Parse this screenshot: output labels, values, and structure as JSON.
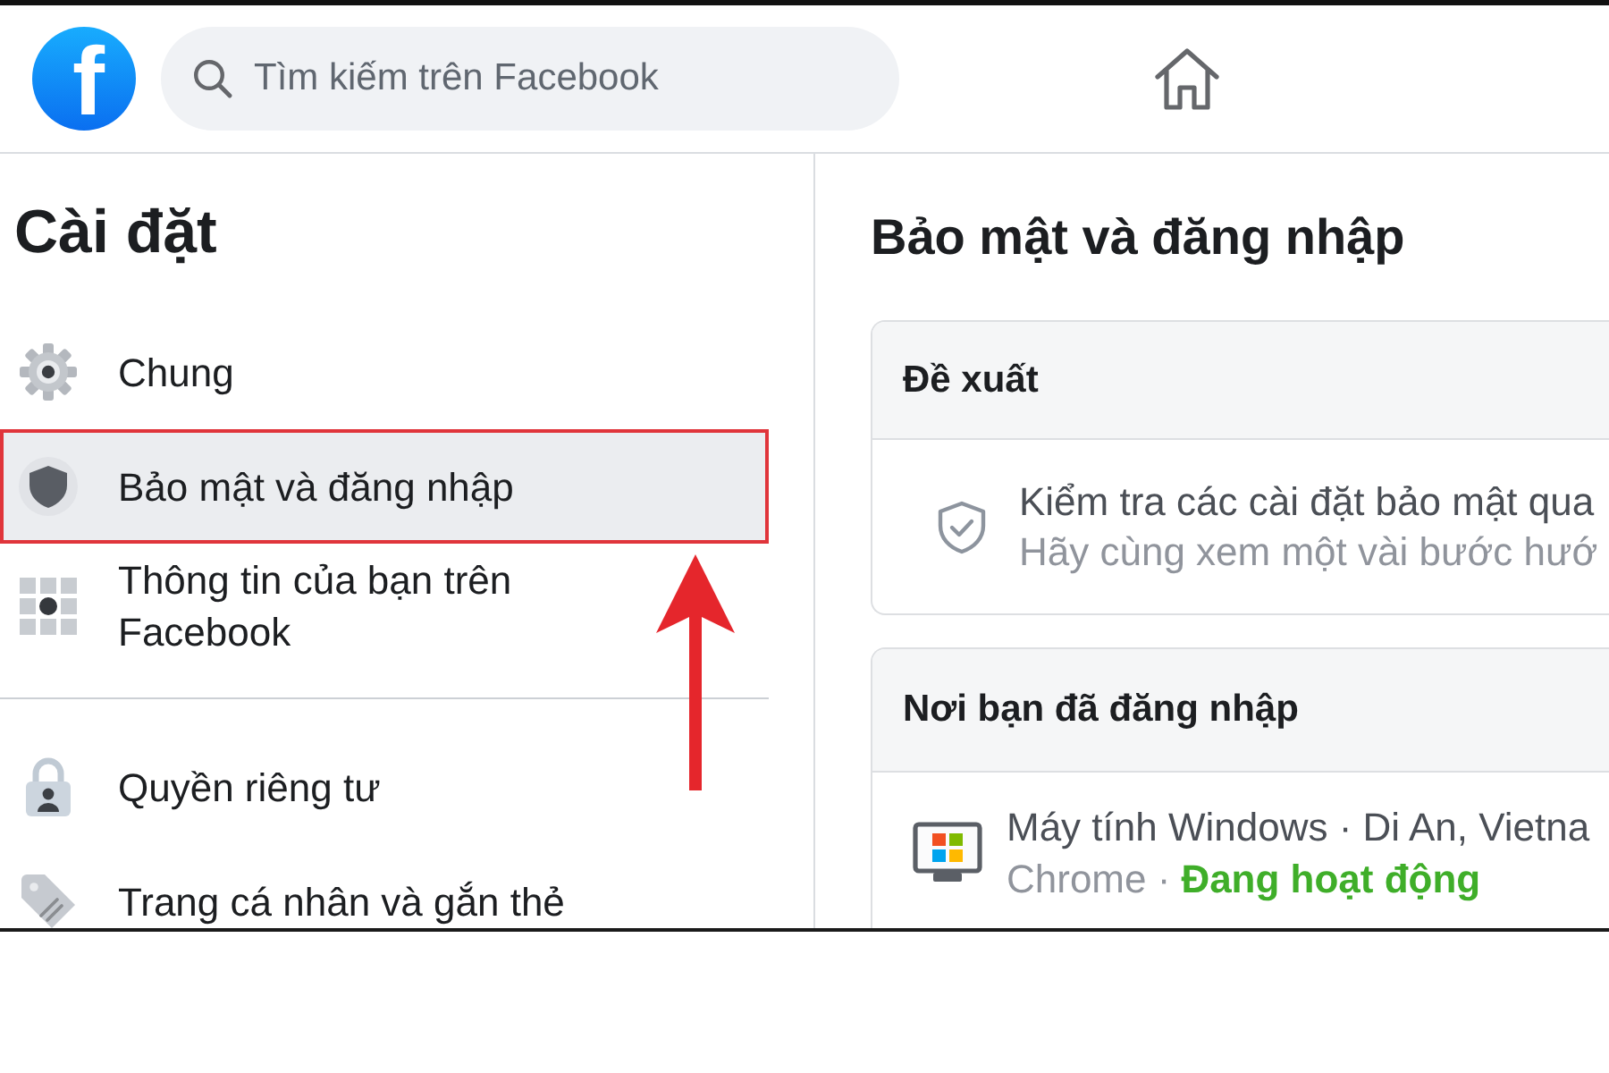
{
  "header": {
    "logo": "f",
    "search": {
      "placeholder": "Tìm kiếm trên Facebook"
    }
  },
  "sidebar": {
    "title": "Cài đặt",
    "groups": [
      {
        "items": [
          {
            "label": "Chung",
            "selected": false,
            "highlighted": false
          },
          {
            "label": "Bảo mật và đăng nhập",
            "selected": true,
            "highlighted": true
          },
          {
            "label": "Thông tin của bạn trên Facebook",
            "selected": false,
            "highlighted": false
          }
        ]
      },
      {
        "items": [
          {
            "label": "Quyền riêng tư",
            "selected": false,
            "highlighted": false
          },
          {
            "label": "Trang cá nhân và gắn thẻ",
            "selected": false,
            "highlighted": false
          }
        ]
      }
    ]
  },
  "content": {
    "title": "Bảo mật và đăng nhập",
    "sections": [
      {
        "kind": "suggestion",
        "title": "Đề xuất",
        "line_1": "Kiểm tra các cài đặt bảo mật qua",
        "line_2": "Hãy cùng xem một vài bước hướ"
      },
      {
        "kind": "session",
        "title": "Nơi bạn đã đăng nhập",
        "device": "Máy tính Windows · Di An, Vietna",
        "browser": "Chrome ·",
        "status": "Đang hoạt động"
      }
    ]
  }
}
